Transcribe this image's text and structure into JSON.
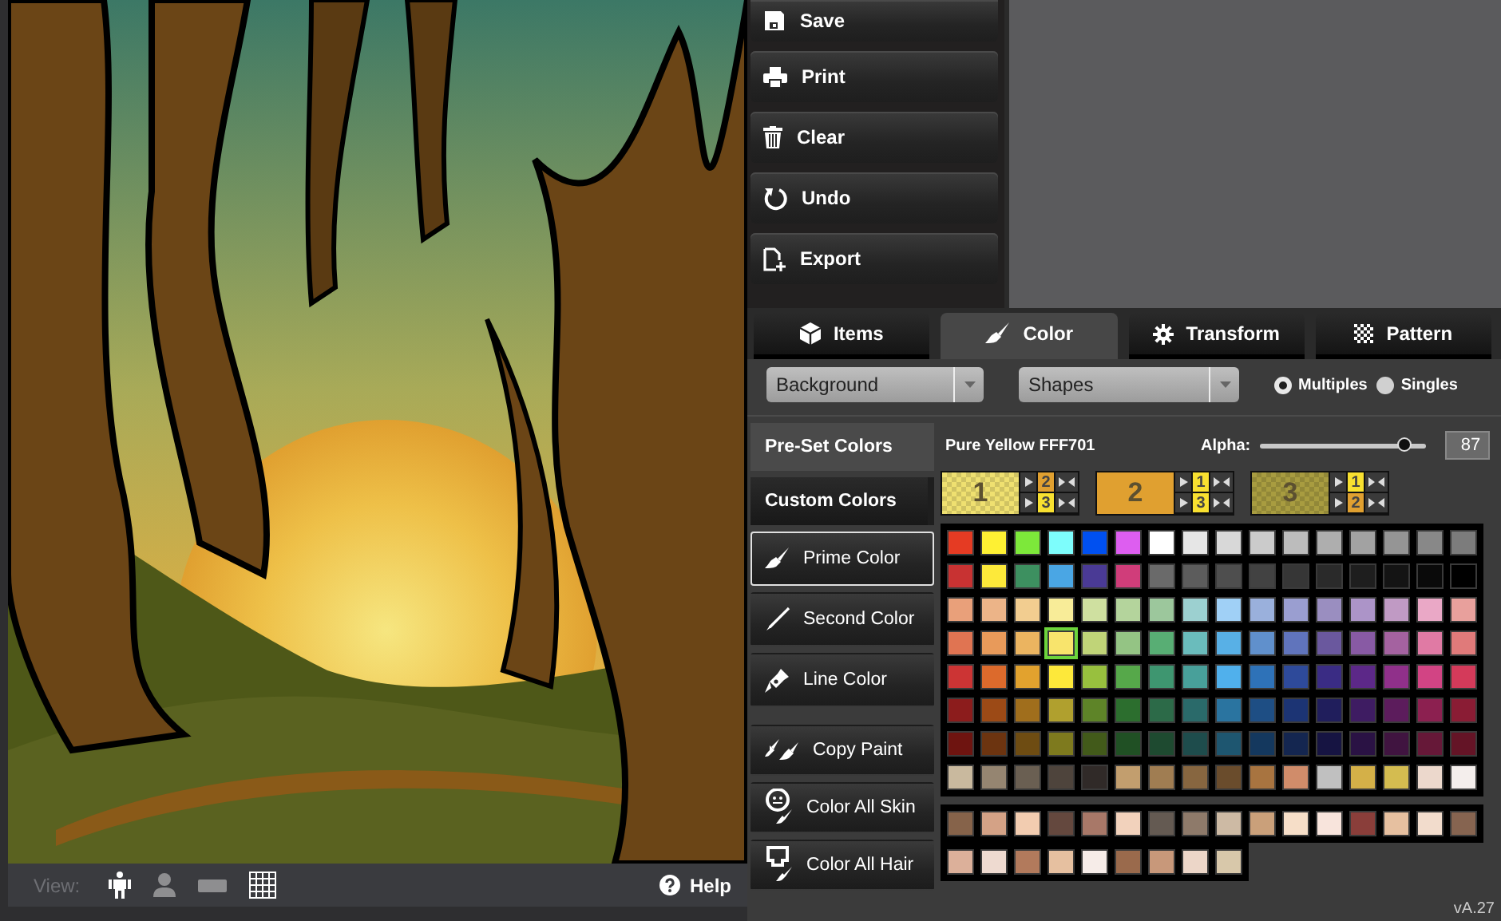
{
  "file_buttons": [
    "Save",
    "Print",
    "Clear",
    "Undo",
    "Export"
  ],
  "tabs": [
    {
      "label": "Items",
      "selected": false
    },
    {
      "label": "Color",
      "selected": true
    },
    {
      "label": "Transform",
      "selected": false
    },
    {
      "label": "Pattern",
      "selected": false
    }
  ],
  "dropdowns": [
    {
      "value": "Background"
    },
    {
      "value": "Shapes"
    }
  ],
  "apply_mode": [
    {
      "label": "Multiples",
      "selected": true
    },
    {
      "label": "Singles",
      "selected": false
    }
  ],
  "palette_sources": [
    {
      "label": "Pre-Set Colors",
      "selected": true
    },
    {
      "label": "Custom Colors",
      "selected": false
    }
  ],
  "paint_targets": [
    {
      "label": "Prime Color",
      "selected": true
    },
    {
      "label": "Second Color",
      "selected": false
    },
    {
      "label": "Line Color",
      "selected": false
    }
  ],
  "actions": [
    "Copy Paint",
    "Color All Skin",
    "Color All Hair"
  ],
  "color_name": "Pure Yellow FFF701",
  "alpha": {
    "label": "Alpha:",
    "level": 0.87,
    "reading": "87"
  },
  "color_slots": [
    {
      "number": "1",
      "color": "#efe070",
      "pattern": true,
      "swaps": [
        {
          "number": "2",
          "color": "#e0a030"
        },
        {
          "number": "3",
          "color": "#f8e030"
        }
      ]
    },
    {
      "number": "2",
      "color": "#e0a030",
      "pattern": false,
      "swaps": [
        {
          "number": "1",
          "color": "#f8e030"
        },
        {
          "number": "3",
          "color": "#f8e030"
        }
      ]
    },
    {
      "number": "3",
      "color": "#a89c40",
      "pattern": true,
      "swaps": [
        {
          "number": "1",
          "color": "#f8e030"
        },
        {
          "number": "2",
          "color": "#e0a030"
        }
      ]
    }
  ],
  "palette": {
    "rows": [
      [
        {
          "color": "#e53b23",
          "selected": false
        },
        {
          "color": "#fef033",
          "selected": false
        },
        {
          "color": "#7de83a",
          "selected": false
        },
        {
          "color": "#7dfdfc",
          "selected": false
        },
        {
          "color": "#0050f0",
          "selected": false
        },
        {
          "color": "#dd5ef0",
          "selected": false
        },
        {
          "color": "#ffffff",
          "selected": false
        },
        {
          "color": "#e6e6e6",
          "selected": false
        },
        {
          "color": "#d8d8d8",
          "selected": false
        },
        {
          "color": "#cbcbcb",
          "selected": false
        },
        {
          "color": "#bcbcbc",
          "selected": false
        },
        {
          "color": "#aeaeae",
          "selected": false
        },
        {
          "color": "#a2a2a2",
          "selected": false
        },
        {
          "color": "#959595",
          "selected": false
        },
        {
          "color": "#888888",
          "selected": false
        },
        {
          "color": "#7c7c7c",
          "selected": false
        }
      ],
      [
        {
          "color": "#c83232",
          "selected": false
        },
        {
          "color": "#fde93a",
          "selected": false
        },
        {
          "color": "#3d9060",
          "selected": false
        },
        {
          "color": "#4aa6e4",
          "selected": false
        },
        {
          "color": "#4a3a95",
          "selected": false
        },
        {
          "color": "#d03d7a",
          "selected": false
        },
        {
          "color": "#6a6a6a",
          "selected": false
        },
        {
          "color": "#5c5c5c",
          "selected": false
        },
        {
          "color": "#4e4e4e",
          "selected": false
        },
        {
          "color": "#424242",
          "selected": false
        },
        {
          "color": "#363636",
          "selected": false
        },
        {
          "color": "#2a2a2a",
          "selected": false
        },
        {
          "color": "#1e1e1e",
          "selected": false
        },
        {
          "color": "#141414",
          "selected": false
        },
        {
          "color": "#0a0a0a",
          "selected": false
        },
        {
          "color": "#000000",
          "selected": false
        }
      ],
      [
        {
          "color": "#e9a07a",
          "selected": false
        },
        {
          "color": "#ecb488",
          "selected": false
        },
        {
          "color": "#f2cd90",
          "selected": false
        },
        {
          "color": "#f8ec98",
          "selected": false
        },
        {
          "color": "#cfe0a0",
          "selected": false
        },
        {
          "color": "#b4d49c",
          "selected": false
        },
        {
          "color": "#9cc79c",
          "selected": false
        },
        {
          "color": "#9cd0d0",
          "selected": false
        },
        {
          "color": "#a0d0f6",
          "selected": false
        },
        {
          "color": "#9ab0dc",
          "selected": false
        },
        {
          "color": "#9a9ed0",
          "selected": false
        },
        {
          "color": "#9a8ec0",
          "selected": false
        },
        {
          "color": "#ac94c8",
          "selected": false
        },
        {
          "color": "#c09ac4",
          "selected": false
        },
        {
          "color": "#eaa8c6",
          "selected": false
        },
        {
          "color": "#e8a09c",
          "selected": false
        }
      ],
      [
        {
          "color": "#e07452",
          "selected": false
        },
        {
          "color": "#e89a5a",
          "selected": false
        },
        {
          "color": "#ebb460",
          "selected": false
        },
        {
          "color": "#f8e46c",
          "selected": true
        },
        {
          "color": "#c0d478",
          "selected": false
        },
        {
          "color": "#94c484",
          "selected": false
        },
        {
          "color": "#58ae74",
          "selected": false
        },
        {
          "color": "#6abcbc",
          "selected": false
        },
        {
          "color": "#58b0e6",
          "selected": false
        },
        {
          "color": "#6090cc",
          "selected": false
        },
        {
          "color": "#6074bc",
          "selected": false
        },
        {
          "color": "#6a589e",
          "selected": false
        },
        {
          "color": "#885aa4",
          "selected": false
        },
        {
          "color": "#a462a0",
          "selected": false
        },
        {
          "color": "#e07aa4",
          "selected": false
        },
        {
          "color": "#e07a7a",
          "selected": false
        }
      ],
      [
        {
          "color": "#cc3434",
          "selected": false
        },
        {
          "color": "#dc6a2c",
          "selected": false
        },
        {
          "color": "#e2a22e",
          "selected": false
        },
        {
          "color": "#fde83a",
          "selected": false
        },
        {
          "color": "#98c03e",
          "selected": false
        },
        {
          "color": "#56a84a",
          "selected": false
        },
        {
          "color": "#3e9670",
          "selected": false
        },
        {
          "color": "#48a09a",
          "selected": false
        },
        {
          "color": "#50b0ec",
          "selected": false
        },
        {
          "color": "#2e72b8",
          "selected": false
        },
        {
          "color": "#2e4a9a",
          "selected": false
        },
        {
          "color": "#3a2c84",
          "selected": false
        },
        {
          "color": "#5c2888",
          "selected": false
        },
        {
          "color": "#90308a",
          "selected": false
        },
        {
          "color": "#d24484",
          "selected": false
        },
        {
          "color": "#d43a5a",
          "selected": false
        }
      ],
      [
        {
          "color": "#8c1c1c",
          "selected": false
        },
        {
          "color": "#9c4a16",
          "selected": false
        },
        {
          "color": "#a06e1c",
          "selected": false
        },
        {
          "color": "#b0a02e",
          "selected": false
        },
        {
          "color": "#5e8428",
          "selected": false
        },
        {
          "color": "#2c6e2e",
          "selected": false
        },
        {
          "color": "#2c6a48",
          "selected": false
        },
        {
          "color": "#2a6a6a",
          "selected": false
        },
        {
          "color": "#2a74a0",
          "selected": false
        },
        {
          "color": "#1e4e84",
          "selected": false
        },
        {
          "color": "#1c3474",
          "selected": false
        },
        {
          "color": "#201e5c",
          "selected": false
        },
        {
          "color": "#3e1c62",
          "selected": false
        },
        {
          "color": "#5c1c5c",
          "selected": false
        },
        {
          "color": "#8c2050",
          "selected": false
        },
        {
          "color": "#8a1c34",
          "selected": false
        }
      ],
      [
        {
          "color": "#6e1410",
          "selected": false
        },
        {
          "color": "#6c3410",
          "selected": false
        },
        {
          "color": "#6e4c12",
          "selected": false
        },
        {
          "color": "#7e7a1e",
          "selected": false
        },
        {
          "color": "#425a1a",
          "selected": false
        },
        {
          "color": "#205024",
          "selected": false
        },
        {
          "color": "#1e4a30",
          "selected": false
        },
        {
          "color": "#1e4c4c",
          "selected": false
        },
        {
          "color": "#1e5670",
          "selected": false
        },
        {
          "color": "#14385e",
          "selected": false
        },
        {
          "color": "#142650",
          "selected": false
        },
        {
          "color": "#161442",
          "selected": false
        },
        {
          "color": "#2a1244",
          "selected": false
        },
        {
          "color": "#401440",
          "selected": false
        },
        {
          "color": "#661838",
          "selected": false
        },
        {
          "color": "#641426",
          "selected": false
        }
      ],
      [
        {
          "color": "#c9b99e",
          "selected": false
        },
        {
          "color": "#958571",
          "selected": false
        },
        {
          "color": "#6a5f52",
          "selected": false
        },
        {
          "color": "#4e443c",
          "selected": false
        },
        {
          "color": "#302a28",
          "selected": false
        },
        {
          "color": "#c29e6e",
          "selected": false
        },
        {
          "color": "#a07d52",
          "selected": false
        },
        {
          "color": "#876640",
          "selected": false
        },
        {
          "color": "#6a4c2c",
          "selected": false
        },
        {
          "color": "#a87440",
          "selected": false
        },
        {
          "color": "#d08c6a",
          "selected": false
        },
        {
          "color": "#c0c0c0",
          "selected": false
        },
        {
          "color": "#d4b048",
          "selected": false
        },
        {
          "color": "#d4bc50",
          "selected": false
        },
        {
          "color": "#ecd8cc",
          "selected": false
        },
        {
          "color": "#f4eeec",
          "selected": false
        }
      ]
    ]
  },
  "skin_palette": {
    "rows": [
      [
        {
          "color": "#86634a",
          "selected": false
        },
        {
          "color": "#d4a286",
          "selected": false
        },
        {
          "color": "#f2ccb0",
          "selected": false
        },
        {
          "color": "#64483e",
          "selected": false
        },
        {
          "color": "#a87868",
          "selected": false
        },
        {
          "color": "#f2d2bc",
          "selected": false
        },
        {
          "color": "#645a52",
          "selected": false
        },
        {
          "color": "#8e7a6a",
          "selected": false
        },
        {
          "color": "#cdbaa4",
          "selected": false
        },
        {
          "color": "#caa07a",
          "selected": false
        },
        {
          "color": "#f6dec8",
          "selected": false
        },
        {
          "color": "#f8e4dc",
          "selected": false
        },
        {
          "color": "#8a3e3a",
          "selected": false
        },
        {
          "color": "#e6c0a0",
          "selected": false
        },
        {
          "color": "#f2dccc",
          "selected": false
        },
        {
          "color": "#866450",
          "selected": false
        }
      ],
      [
        {
          "color": "#dcb09a",
          "selected": false
        },
        {
          "color": "#eedad0",
          "selected": false
        },
        {
          "color": "#b27a5c",
          "selected": false
        },
        {
          "color": "#e6c0a0",
          "selected": false
        },
        {
          "color": "#f6ece8",
          "selected": false
        },
        {
          "color": "#9a6a4c",
          "selected": false
        },
        {
          "color": "#c8987a",
          "selected": false
        },
        {
          "color": "#ecd6c8",
          "selected": false
        },
        {
          "color": "#d8c8aa",
          "selected": false
        }
      ]
    ]
  },
  "view_bar": {
    "label": "View:",
    "buttons": [
      {
        "selected": true
      },
      {
        "selected": false
      },
      {
        "selected": false
      },
      {
        "selected": true
      }
    ]
  },
  "help": "Help",
  "version": "vA.27"
}
